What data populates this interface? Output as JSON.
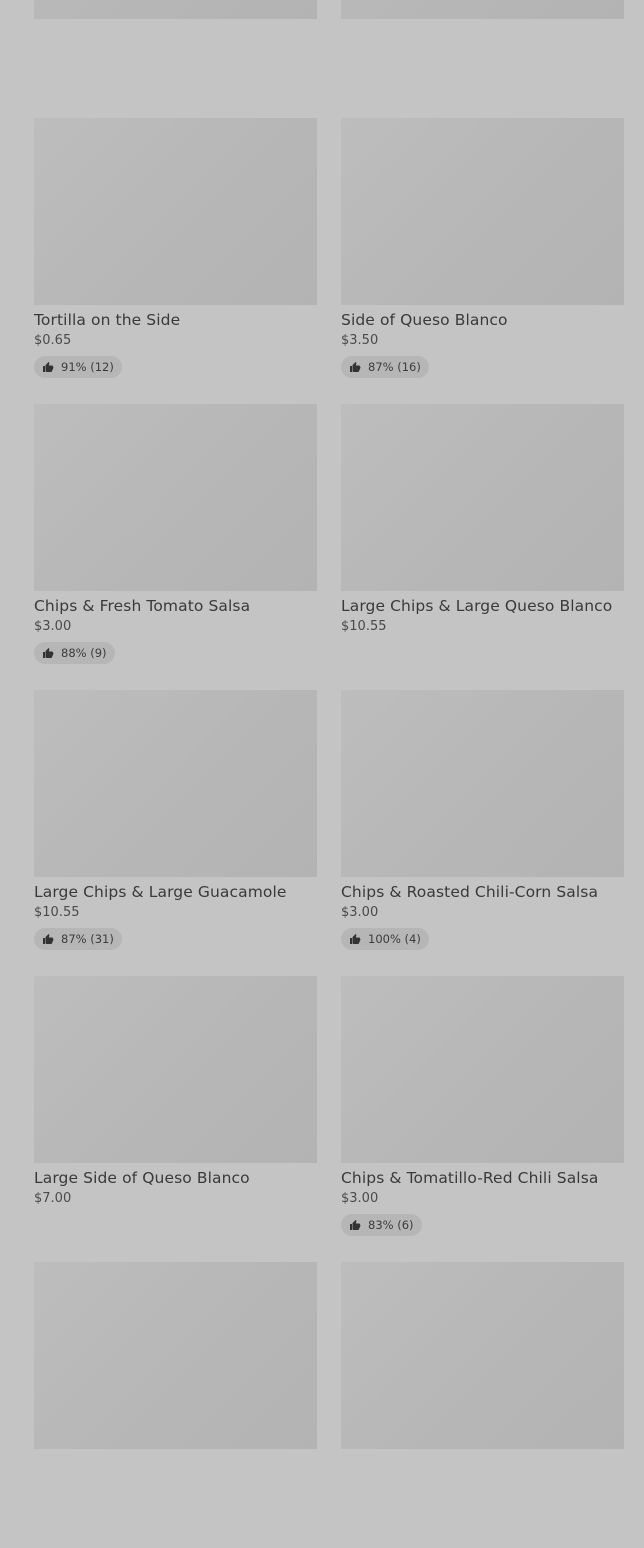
{
  "items": [
    {
      "name": "",
      "price": "",
      "rating": ""
    },
    {
      "name": "",
      "price": "",
      "rating": ""
    },
    {
      "name": "Tortilla on the Side",
      "price": "$0.65",
      "rating": "91% (12)"
    },
    {
      "name": "Side of Queso Blanco",
      "price": "$3.50",
      "rating": "87% (16)"
    },
    {
      "name": "Chips & Fresh Tomato Salsa",
      "price": "$3.00",
      "rating": "88% (9)"
    },
    {
      "name": "Large Chips & Large Queso Blanco",
      "price": "$10.55",
      "rating": ""
    },
    {
      "name": "Large Chips & Large Guacamole",
      "price": "$10.55",
      "rating": "87% (31)"
    },
    {
      "name": "Chips & Roasted Chili-Corn Salsa",
      "price": "$3.00",
      "rating": "100% (4)"
    },
    {
      "name": "Large Side of Queso Blanco",
      "price": "$7.00",
      "rating": ""
    },
    {
      "name": "Chips & Tomatillo-Red Chili Salsa",
      "price": "$3.00",
      "rating": "83% (6)"
    },
    {
      "name": "",
      "price": "",
      "rating": ""
    },
    {
      "name": "",
      "price": "",
      "rating": ""
    }
  ],
  "icons": {
    "rating": "thumbs-up-icon"
  }
}
